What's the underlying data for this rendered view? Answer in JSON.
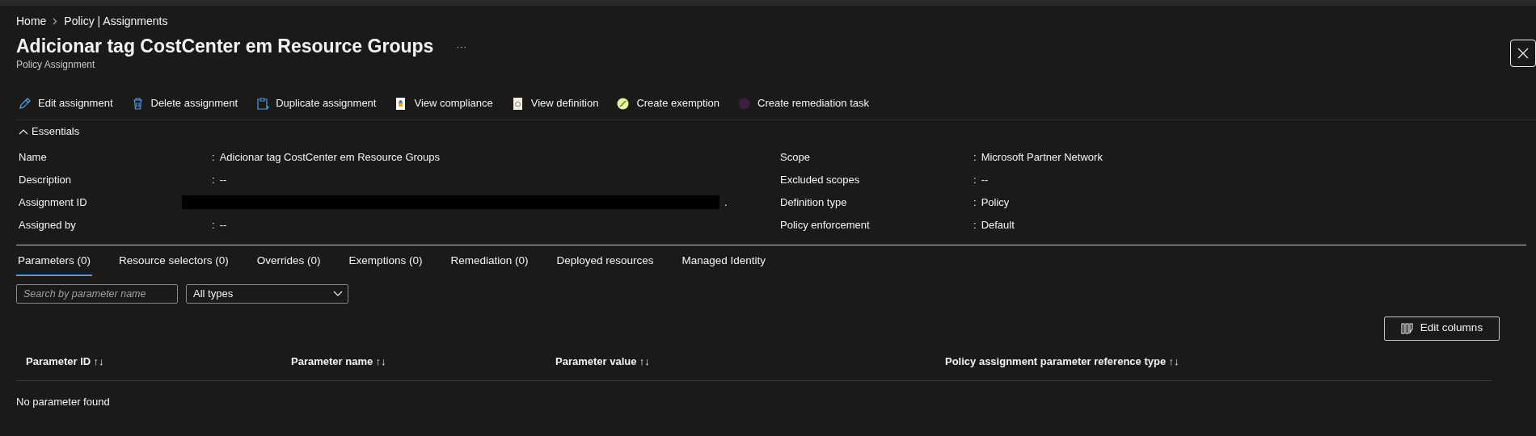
{
  "breadcrumb": [
    "Home",
    "Policy | Assignments"
  ],
  "title": "Adicionar tag CostCenter em Resource Groups",
  "more": "···",
  "subtitle": "Policy Assignment",
  "toolbar": [
    {
      "label": "Edit assignment",
      "kind": "edit"
    },
    {
      "label": "Delete assignment",
      "kind": "delete"
    },
    {
      "label": "Duplicate assignment",
      "kind": "duplicate"
    },
    {
      "label": "View compliance",
      "kind": "compliance"
    },
    {
      "label": "View definition",
      "kind": "definition"
    },
    {
      "label": "Create exemption",
      "kind": "exemption"
    },
    {
      "label": "Create remediation task",
      "kind": "remediation"
    }
  ],
  "essentials": {
    "label": "Essentials",
    "expanded": true,
    "left": [
      {
        "label": "Name",
        "separator": ":",
        "value": "Adicionar tag CostCenter em Resource Groups"
      },
      {
        "label": "Description",
        "separator": ":",
        "value": "--"
      },
      {
        "label": "Assignment ID",
        "redacted": true,
        "value": "."
      },
      {
        "label": "Assigned by",
        "separator": ":",
        "value": "--"
      }
    ],
    "right": [
      {
        "label": "Scope",
        "separator": ":",
        "value": "Microsoft Partner Network"
      },
      {
        "label": "Excluded scopes",
        "separator": ":",
        "value": "--"
      },
      {
        "label": "Definition type",
        "separator": ":",
        "value": "Policy"
      },
      {
        "label": "Policy enforcement",
        "separator": ":",
        "value": "Default"
      }
    ]
  },
  "tabs": [
    {
      "label": "Parameters (0)",
      "selected": true
    },
    {
      "label": "Resource selectors (0)",
      "selected": false
    },
    {
      "label": "Overrides (0)",
      "selected": false
    },
    {
      "label": "Exemptions (0)",
      "selected": false
    },
    {
      "label": "Remediation (0)",
      "selected": false
    },
    {
      "label": "Deployed resources",
      "selected": false
    },
    {
      "label": "Managed Identity",
      "selected": false
    }
  ],
  "search": {
    "placeholder": "Search by parameter name"
  },
  "type_filter": {
    "value": "All types"
  },
  "edit_columns": "Edit columns",
  "table": {
    "columns": [
      "Parameter ID",
      "Parameter name",
      "Parameter value",
      "Policy assignment parameter reference type"
    ],
    "sort_icon": "↑↓",
    "empty": "No parameter found"
  }
}
